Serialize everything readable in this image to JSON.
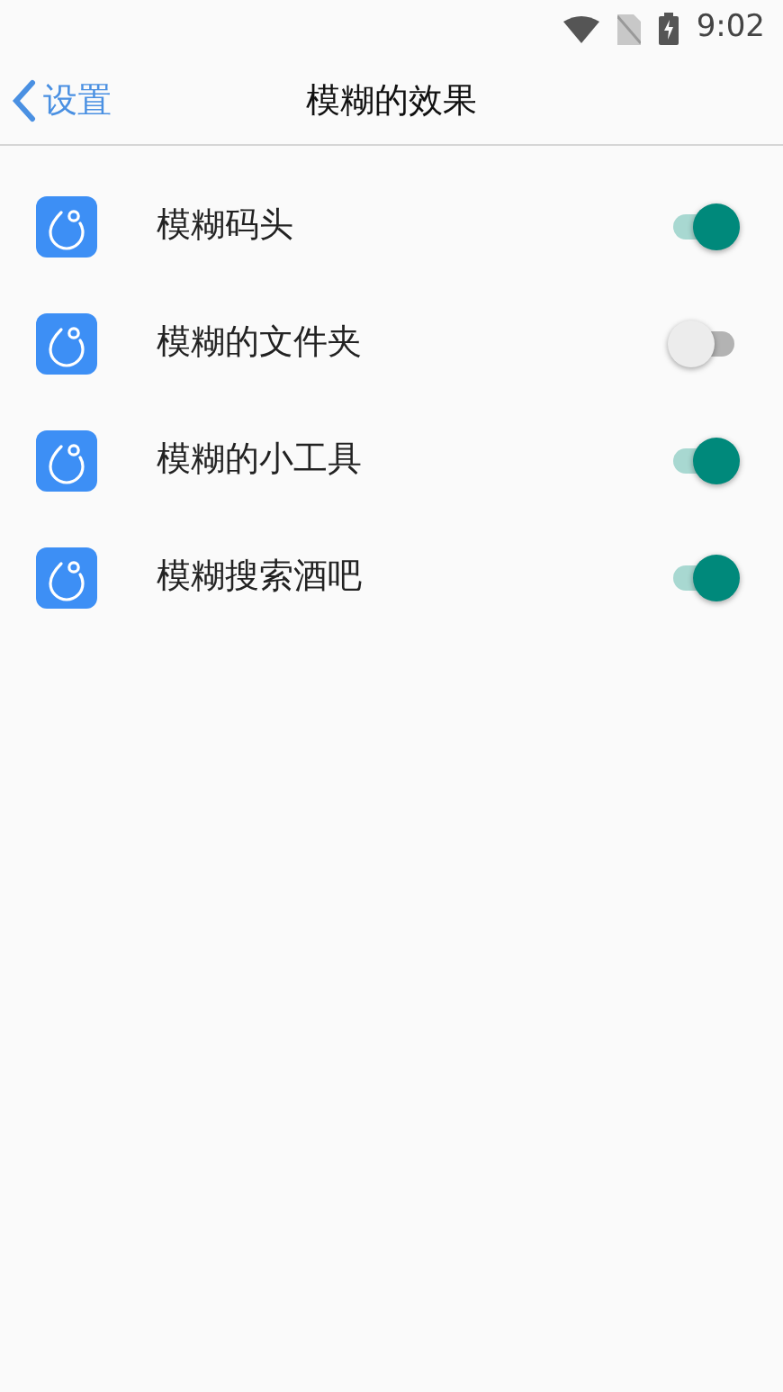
{
  "status_bar": {
    "time": "9:02"
  },
  "nav_bar": {
    "back_label": "设置",
    "title": "模糊的效果"
  },
  "settings": [
    {
      "label": "模糊码头",
      "on": true
    },
    {
      "label": "模糊的文件夹",
      "on": false
    },
    {
      "label": "模糊的小工具",
      "on": true
    },
    {
      "label": "模糊搜索酒吧",
      "on": true
    }
  ]
}
